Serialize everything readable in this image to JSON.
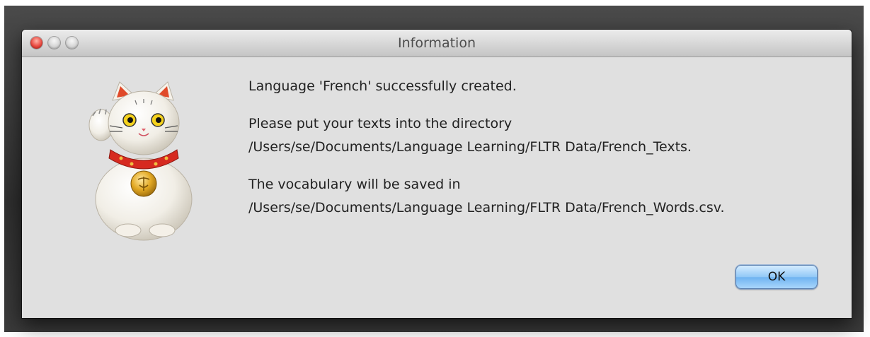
{
  "window": {
    "title": "Information"
  },
  "messages": [
    [
      "Language 'French' successfully created."
    ],
    [
      "Please put your texts into the directory",
      "/Users/se/Documents/Language Learning/FLTR Data/French_Texts."
    ],
    [
      "The vocabulary will be saved in",
      "/Users/se/Documents/Language Learning/FLTR Data/French_Words.csv."
    ]
  ],
  "buttons": {
    "ok_label": "OK"
  },
  "icon": {
    "name": "lucky-cat-icon"
  }
}
